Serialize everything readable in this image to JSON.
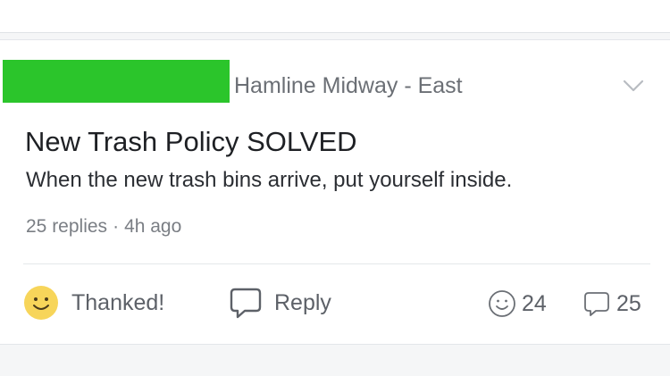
{
  "post": {
    "neighborhood": "Hamline Midway - East",
    "title": "New Trash Policy SOLVED",
    "body": "When the new trash bins arrive, put yourself inside.",
    "replies": "25 replies",
    "separator": "·",
    "age": "4h ago"
  },
  "actions": {
    "thank_label": "Thanked!",
    "reply_label": "Reply",
    "thanks_count": "24",
    "reply_count": "25"
  },
  "icons": {
    "menu": "chevron-down-icon",
    "thank": "smiley-filled-icon",
    "reply": "speech-bubble-icon",
    "thanks_counter": "smiley-outline-icon",
    "reply_counter": "speech-bubble-icon"
  },
  "colors": {
    "redaction": "#2bc52b",
    "thanked_smiley": "#f7d55a",
    "text_primary": "#1e2024",
    "text_secondary": "#6b6f75"
  }
}
